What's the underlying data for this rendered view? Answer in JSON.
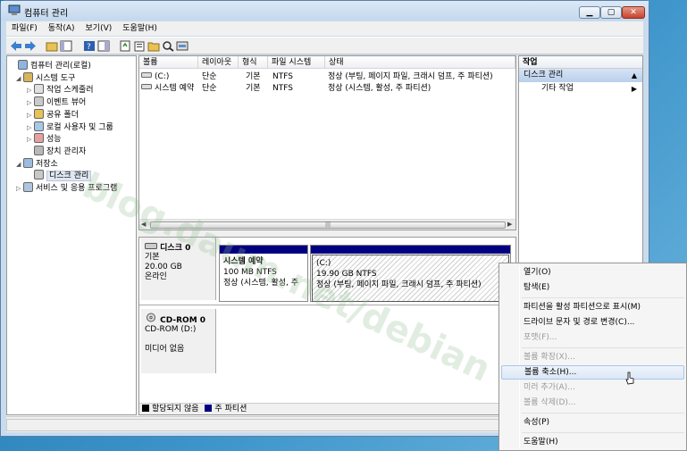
{
  "window": {
    "title": "컴퓨터 관리"
  },
  "menubar": [
    "파일(F)",
    "동작(A)",
    "보기(V)",
    "도움말(H)"
  ],
  "tree": [
    {
      "label": "컴퓨터 관리(로컬)",
      "level": 0,
      "expander": "",
      "icon": "computer-icon"
    },
    {
      "label": "시스템 도구",
      "level": 1,
      "expander": "◢",
      "icon": "tools-icon"
    },
    {
      "label": "작업 스케줄러",
      "level": 2,
      "expander": "▷",
      "icon": "clock-icon"
    },
    {
      "label": "이벤트 뷰어",
      "level": 2,
      "expander": "▷",
      "icon": "event-viewer-icon"
    },
    {
      "label": "공유 폴더",
      "level": 2,
      "expander": "▷",
      "icon": "shared-folder-icon"
    },
    {
      "label": "로컬 사용자 및 그룹",
      "level": 2,
      "expander": "▷",
      "icon": "users-icon"
    },
    {
      "label": "성능",
      "level": 2,
      "expander": "▷",
      "icon": "performance-icon"
    },
    {
      "label": "장치 관리자",
      "level": 2,
      "expander": "",
      "icon": "device-manager-icon"
    },
    {
      "label": "저장소",
      "level": 1,
      "expander": "◢",
      "icon": "storage-icon"
    },
    {
      "label": "디스크 관리",
      "level": 2,
      "expander": "",
      "icon": "disk-management-icon",
      "selected": true
    },
    {
      "label": "서비스 및 응용 프로그램",
      "level": 1,
      "expander": "▷",
      "icon": "services-icon"
    }
  ],
  "volumes": {
    "headers": [
      "볼륨",
      "레이아웃",
      "형식",
      "파일 시스템",
      "상태"
    ],
    "rows": [
      [
        "(C:)",
        "단순",
        "기본",
        "NTFS",
        "정상 (부팅, 페이지 파일, 크래시 덤프, 주 파티션)"
      ],
      [
        "시스템 예약",
        "단순",
        "기본",
        "NTFS",
        "정상 (시스템, 활성, 주 파티션)"
      ]
    ]
  },
  "disks": [
    {
      "name": "디스크 0",
      "lines": [
        "기본",
        "20.00 GB",
        "온라인"
      ]
    },
    {
      "name": "CD-ROM 0",
      "lines": [
        "CD-ROM (D:)",
        "",
        "미디어 없음"
      ]
    }
  ],
  "partitions": [
    {
      "name": "시스템 예약",
      "size": "100 MB NTFS",
      "status": "정상 (시스템, 활성, 주"
    },
    {
      "name": "(C:)",
      "size": "19.90 GB NTFS",
      "status": "정상 (부팅, 페이지 파일, 크래시 덤프, 주 파티션)"
    }
  ],
  "legend": [
    {
      "label": "할당되지 않음",
      "color": "#000000"
    },
    {
      "label": "주 파티션",
      "color": "#000080"
    }
  ],
  "actions": {
    "header": "작업",
    "selected": "디스크 관리",
    "more": "기타 작업"
  },
  "context_menu": [
    {
      "label": "열기(O)",
      "disabled": false
    },
    {
      "label": "탐색(E)",
      "disabled": false
    },
    {
      "separator": true
    },
    {
      "label": "파티션을 활성 파티션으로 표시(M)",
      "disabled": false
    },
    {
      "label": "드라이브 문자 및 경로 변경(C)...",
      "disabled": false
    },
    {
      "label": "포맷(F)...",
      "disabled": true
    },
    {
      "separator": true
    },
    {
      "label": "볼륨 확장(X)...",
      "disabled": true
    },
    {
      "label": "볼륨 축소(H)...",
      "disabled": false,
      "hover": true
    },
    {
      "label": "미러 추가(A)...",
      "disabled": true
    },
    {
      "label": "볼륨 삭제(D)...",
      "disabled": true
    },
    {
      "separator": true
    },
    {
      "label": "속성(P)",
      "disabled": false
    },
    {
      "separator": true
    },
    {
      "label": "도움말(H)",
      "disabled": false
    }
  ],
  "watermark": "blog.daum.net/debian",
  "colors": {
    "accent": "#000080",
    "titlebar": "#c4d8ee",
    "selection": "#b9cfec"
  }
}
